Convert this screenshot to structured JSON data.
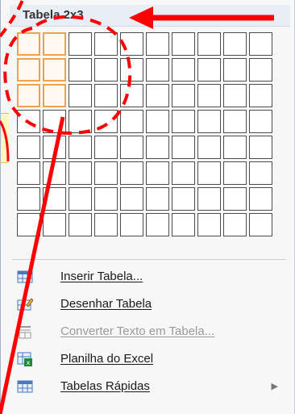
{
  "header": {
    "title": "Tabela 2x3"
  },
  "grid": {
    "columns": 10,
    "rows": 8,
    "selected_columns": 2,
    "selected_rows": 3
  },
  "menu": {
    "items": [
      {
        "label": "Inserir Tabela...",
        "icon": "table-icon",
        "enabled": true
      },
      {
        "label": "Desenhar Tabela",
        "icon": "draw-table-icon",
        "enabled": true
      },
      {
        "label": "Converter Texto em Tabela...",
        "icon": "convert-text-icon",
        "enabled": false
      },
      {
        "label": "Planilha do Excel",
        "icon": "excel-spreadsheet-icon",
        "enabled": true
      },
      {
        "label": "Tabelas Rápidas",
        "icon": "quick-tables-icon",
        "enabled": true,
        "submenu": true
      }
    ]
  },
  "colors": {
    "highlight": "#f3a04a",
    "annotation": "#ff0000"
  }
}
